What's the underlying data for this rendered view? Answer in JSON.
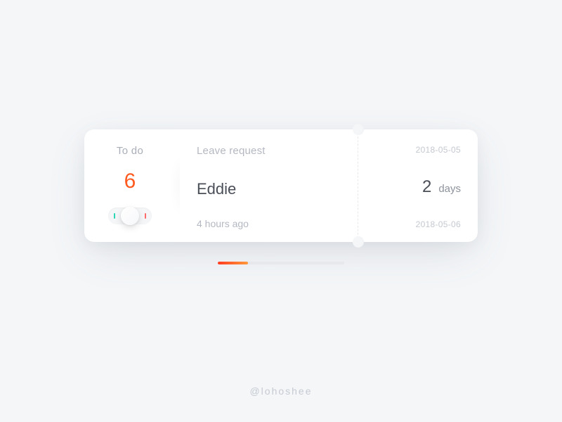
{
  "todo": {
    "label": "To do",
    "count": "6"
  },
  "request": {
    "type": "Leave request",
    "name": "Eddie",
    "ago": "4 hours ago"
  },
  "dates": {
    "start": "2018-05-05",
    "end": "2018-05-06"
  },
  "duration": {
    "value": "2",
    "unit": "days"
  },
  "credit": "@lohoshee"
}
